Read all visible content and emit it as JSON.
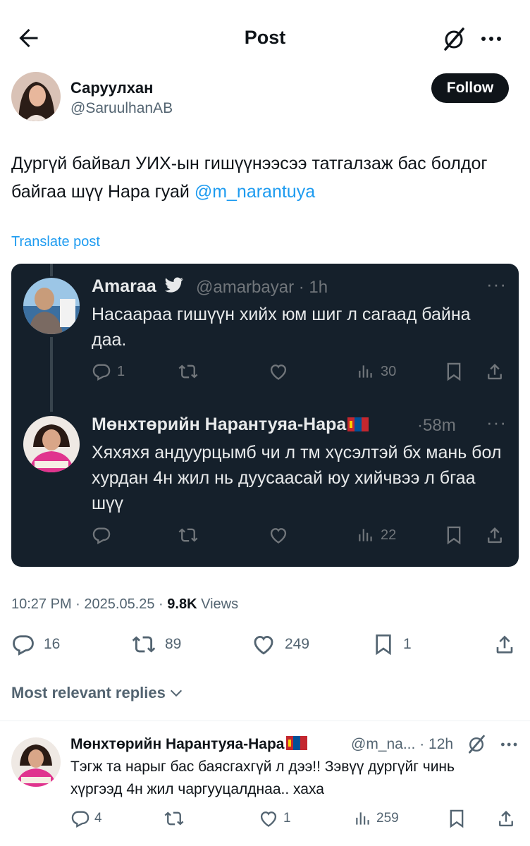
{
  "header": {
    "title": "Post"
  },
  "author": {
    "name": "Саруулхан",
    "handle": "@SaruulhanAB",
    "follow_label": "Follow"
  },
  "post": {
    "text": "Дургүй байвал УИХ-ын гишүүнээсээ татгалзаж бас болдог байгаа шүү Нара гуай ",
    "mention": "@m_narantuya",
    "translate_label": "Translate post",
    "time": "10:27 PM",
    "date": "2025.05.25",
    "views_count": "9.8K",
    "views_label": "Views",
    "stats": {
      "replies": "16",
      "reposts": "89",
      "likes": "249",
      "bookmarks": "1"
    }
  },
  "quoted_thread": [
    {
      "name": "Amaraa",
      "handle": "@amarbayar",
      "time": "1h",
      "text": "Насаараа гишүүн хийх юм шиг л сагаад байна даа.",
      "replies": "1",
      "views": "30"
    },
    {
      "name": "Мөнхтөрийн Нарантуяа-Нара",
      "time": "58m",
      "text": "Хяхяхя андуурцымб чи л тм хүсэлтэй бх мань бол хурдан 4н жил нь дуусаасай юу хийчвээ л бгаа шүү",
      "views": "22"
    }
  ],
  "replies_sort_label": "Most relevant replies",
  "reply": {
    "name": "Мөнхтөрийн Нарантуяа-Нара",
    "handle": "@m_na...",
    "time": "12h",
    "text": "Тэгж та нарыг бас баясгахгүй л дээ!! Зэвүү дургүйг чинь хүргээд 4н жил чаргууцалднаа.. хаха",
    "replies": "4",
    "likes": "1",
    "views": "259"
  },
  "colors": {
    "accent": "#1d9bf0",
    "dark_card": "#15202b",
    "muted": "#536471"
  }
}
